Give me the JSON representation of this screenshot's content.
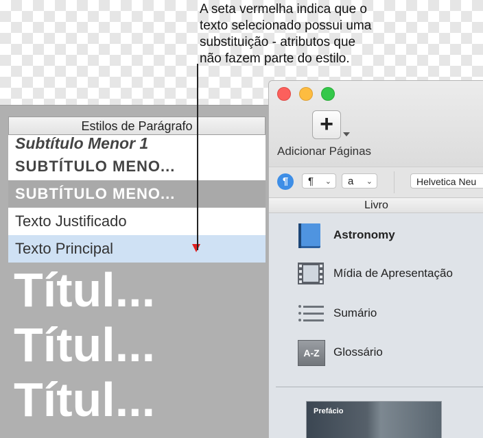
{
  "annotation": "A seta vermelha indica que o\ntexto selecionado possui uma\nsubstituição - atributos que\nnão fazem parte do estilo.",
  "paragraph_styles": {
    "header": "Estilos de Parágrafo",
    "items": [
      "Subtítulo Menor 1",
      "SUBTÍTULO MENO...",
      "SUBTÍTULO MENO...",
      "Texto Justificado",
      "Texto Principal",
      "Títul...",
      "Títul...",
      "Títul..."
    ]
  },
  "window": {
    "toolbar": {
      "add_button_icon": "plus-icon",
      "add_label": "Adicionar Páginas"
    },
    "format_bar": {
      "paragraph_style_icon": "pilcrow-icon",
      "paragraph_popup": "¶",
      "character_popup": "a",
      "font_popup": "Helvetica Neu"
    },
    "section_title": "Livro",
    "sidebar": [
      {
        "label": "Astronomy",
        "icon": "book-icon"
      },
      {
        "label": "Mídia de Apresentação",
        "icon": "film-icon"
      },
      {
        "label": "Sumário",
        "icon": "list-icon"
      },
      {
        "label": "Glossário",
        "icon": "az-icon",
        "icon_text": "A-Z"
      }
    ],
    "thumbnail_label": "Prefácio"
  },
  "colors": {
    "override_marker": "#e02020",
    "selected_row": "#cfe1f4",
    "accent_blue": "#3e8ee6"
  }
}
